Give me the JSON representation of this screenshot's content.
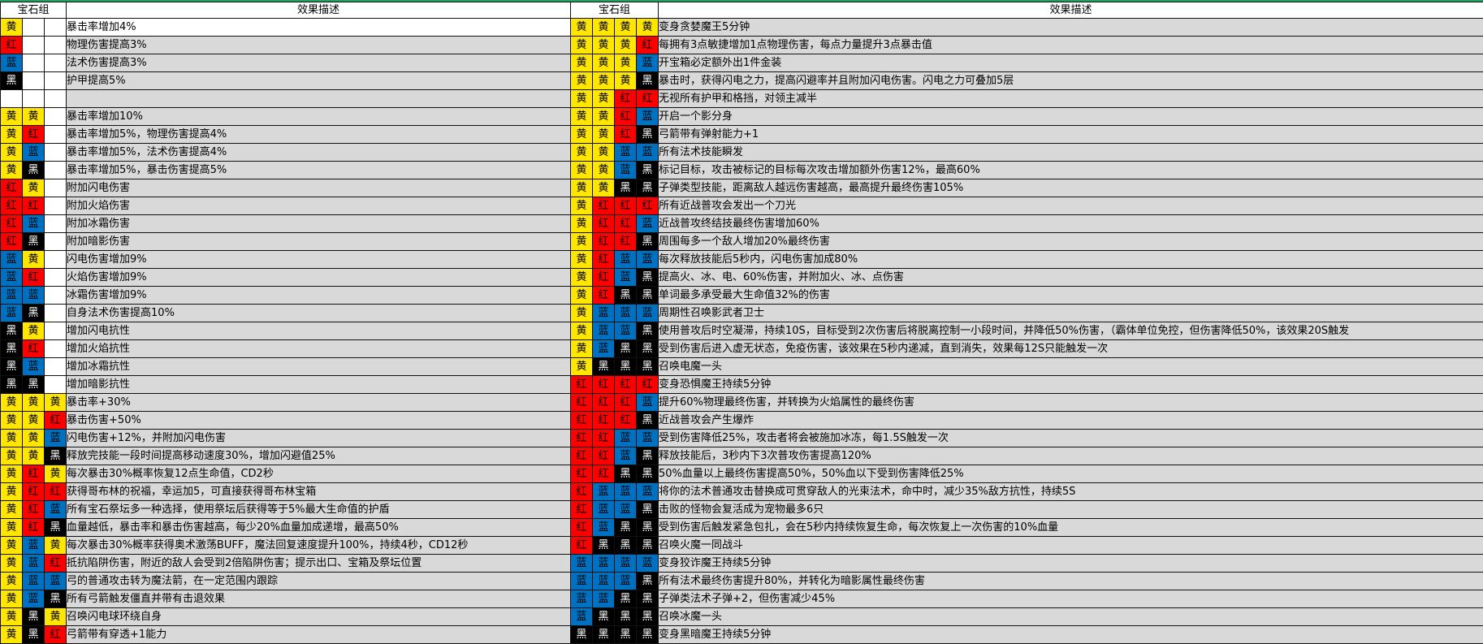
{
  "colors": {
    "yellow": "#ffe600",
    "red": "#ff0000",
    "blue": "#0070c0",
    "black": "#000000",
    "row_bg": "#d9d9d9",
    "accent": "#21a366"
  },
  "left": {
    "gem_header": "宝石组",
    "desc_header": "效果描述",
    "rows": [
      {
        "gems": [
          "黄",
          "",
          ""
        ],
        "desc": "暴击率增加4%",
        "highlight": true
      },
      {
        "gems": [
          "红",
          "",
          ""
        ],
        "desc": "物理伤害提高3%"
      },
      {
        "gems": [
          "蓝",
          "",
          ""
        ],
        "desc": "法术伤害提高3%"
      },
      {
        "gems": [
          "黑",
          "",
          ""
        ],
        "desc": "护甲提高5%"
      },
      {
        "gems": [
          "",
          "",
          ""
        ],
        "desc": ""
      },
      {
        "gems": [
          "黄",
          "黄",
          ""
        ],
        "desc": "暴击率增加10%"
      },
      {
        "gems": [
          "黄",
          "红",
          ""
        ],
        "desc": "暴击率增加5%，物理伤害提高4%"
      },
      {
        "gems": [
          "黄",
          "蓝",
          ""
        ],
        "desc": "暴击率增加5%，法术伤害提高4%"
      },
      {
        "gems": [
          "黄",
          "黑",
          ""
        ],
        "desc": "暴击率增加5%，暴击伤害提高5%"
      },
      {
        "gems": [
          "红",
          "黄",
          ""
        ],
        "desc": "附加闪电伤害"
      },
      {
        "gems": [
          "红",
          "红",
          ""
        ],
        "desc": "附加火焰伤害"
      },
      {
        "gems": [
          "红",
          "蓝",
          ""
        ],
        "desc": "附加冰霜伤害"
      },
      {
        "gems": [
          "红",
          "黑",
          ""
        ],
        "desc": "附加暗影伤害"
      },
      {
        "gems": [
          "蓝",
          "黄",
          ""
        ],
        "desc": "闪电伤害增加9%"
      },
      {
        "gems": [
          "蓝",
          "红",
          ""
        ],
        "desc": "火焰伤害增加9%"
      },
      {
        "gems": [
          "蓝",
          "蓝",
          ""
        ],
        "desc": "冰霜伤害增加9%"
      },
      {
        "gems": [
          "蓝",
          "黑",
          ""
        ],
        "desc": "自身法术伤害提高10%"
      },
      {
        "gems": [
          "黑",
          "黄",
          ""
        ],
        "desc": "增加闪电抗性"
      },
      {
        "gems": [
          "黑",
          "红",
          ""
        ],
        "desc": "增加火焰抗性"
      },
      {
        "gems": [
          "黑",
          "蓝",
          ""
        ],
        "desc": "增加冰霜抗性"
      },
      {
        "gems": [
          "黑",
          "黑",
          ""
        ],
        "desc": "增加暗影抗性"
      },
      {
        "gems": [
          "黄",
          "黄",
          "黄"
        ],
        "desc": "暴击率+30%"
      },
      {
        "gems": [
          "黄",
          "黄",
          "红"
        ],
        "desc": "暴击伤害+50%"
      },
      {
        "gems": [
          "黄",
          "黄",
          "蓝"
        ],
        "desc": "闪电伤害+12%，并附加闪电伤害"
      },
      {
        "gems": [
          "黄",
          "黄",
          "黑"
        ],
        "desc": "释放完技能一段时间提高移动速度30%，增加闪避值25%"
      },
      {
        "gems": [
          "黄",
          "红",
          "黄"
        ],
        "desc": "每次暴击30%概率恢复12点生命值，CD2秒"
      },
      {
        "gems": [
          "黄",
          "红",
          "红"
        ],
        "desc": "获得哥布林的祝福，幸运加5，可直接获得哥布林宝箱"
      },
      {
        "gems": [
          "黄",
          "红",
          "蓝"
        ],
        "desc": "所有宝石祭坛多一种选择，使用祭坛后获得等于5%最大生命值的护盾"
      },
      {
        "gems": [
          "黄",
          "红",
          "黑"
        ],
        "desc": "血量越低，暴击率和暴击伤害越高，每少20%血量加成递增，最高50%"
      },
      {
        "gems": [
          "黄",
          "蓝",
          "黄"
        ],
        "desc": "每次暴击30%概率获得奥术激荡BUFF，魔法回复速度提升100%，持续4秒，CD12秒"
      },
      {
        "gems": [
          "黄",
          "蓝",
          "红"
        ],
        "desc": "抵抗陷阱伤害，附近的敌人会受到2倍陷阱伤害；提示出口、宝箱及祭坛位置"
      },
      {
        "gems": [
          "黄",
          "蓝",
          "蓝"
        ],
        "desc": "弓的普通攻击转为魔法箭，在一定范围内跟踪"
      },
      {
        "gems": [
          "黄",
          "蓝",
          "黑"
        ],
        "desc": "所有弓箭触发僵直并带有击退效果"
      },
      {
        "gems": [
          "黄",
          "黑",
          "黄"
        ],
        "desc": "召唤闪电球环绕自身"
      },
      {
        "gems": [
          "黄",
          "黑",
          "红"
        ],
        "desc": "弓箭带有穿透+1能力"
      }
    ]
  },
  "right": {
    "gem_header": "宝石组",
    "desc_header": "效果描述",
    "rows": [
      {
        "gems": [
          "黄",
          "黄",
          "黄",
          "黄"
        ],
        "desc": "变身贪婪魔王5分钟"
      },
      {
        "gems": [
          "黄",
          "黄",
          "黄",
          "红"
        ],
        "desc": "每拥有3点敏捷增加1点物理伤害，每点力量提升3点暴击值"
      },
      {
        "gems": [
          "黄",
          "黄",
          "黄",
          "蓝"
        ],
        "desc": "开宝箱必定额外出1件金装"
      },
      {
        "gems": [
          "黄",
          "黄",
          "黄",
          "黑"
        ],
        "desc": "暴击时，获得闪电之力，提高闪避率并且附加闪电伤害。闪电之力可叠加5层"
      },
      {
        "gems": [
          "黄",
          "黄",
          "红",
          "红"
        ],
        "desc": "无视所有护甲和格挡，对领主减半"
      },
      {
        "gems": [
          "黄",
          "黄",
          "红",
          "蓝"
        ],
        "desc": "开启一个影分身"
      },
      {
        "gems": [
          "黄",
          "黄",
          "红",
          "黑"
        ],
        "desc": "弓箭带有弹射能力+1"
      },
      {
        "gems": [
          "黄",
          "黄",
          "蓝",
          "蓝"
        ],
        "desc": "所有法术技能瞬发"
      },
      {
        "gems": [
          "黄",
          "黄",
          "蓝",
          "黑"
        ],
        "desc": "标记目标，攻击被标记的目标每次攻击增加额外伤害12%，最高60%"
      },
      {
        "gems": [
          "黄",
          "黄",
          "黑",
          "黑"
        ],
        "desc": "子弹类型技能，距离敌人越远伤害越高，最高提升最终伤害105%"
      },
      {
        "gems": [
          "黄",
          "红",
          "红",
          "红"
        ],
        "desc": "所有近战普攻会发出一个刀光"
      },
      {
        "gems": [
          "黄",
          "红",
          "红",
          "蓝"
        ],
        "desc": "近战普攻终结技最终伤害增加60%"
      },
      {
        "gems": [
          "黄",
          "红",
          "红",
          "黑"
        ],
        "desc": "周围每多一个敌人增加20%最终伤害"
      },
      {
        "gems": [
          "黄",
          "红",
          "蓝",
          "蓝"
        ],
        "desc": "每次释放技能后5秒内，闪电伤害加成80%"
      },
      {
        "gems": [
          "黄",
          "红",
          "蓝",
          "黑"
        ],
        "desc": "提高火、冰、电、60%伤害，并附加火、冰、点伤害"
      },
      {
        "gems": [
          "黄",
          "红",
          "黑",
          "黑"
        ],
        "desc": "单词最多承受最大生命值32%的伤害"
      },
      {
        "gems": [
          "黄",
          "蓝",
          "蓝",
          "蓝"
        ],
        "desc": "周期性召唤影武者卫士"
      },
      {
        "gems": [
          "黄",
          "蓝",
          "蓝",
          "黑"
        ],
        "desc": "使用普攻后时空凝滞，持续10S，目标受到2次伤害后将脱离控制一小段时间，并降低50%伤害，（霸体单位免控，但伤害降低50%，该效果20S触发"
      },
      {
        "gems": [
          "黄",
          "蓝",
          "黑",
          "黑"
        ],
        "desc": "受到伤害后进入虚无状态，免疫伤害，该效果在5秒内递减，直到消失，效果每12S只能触发一次"
      },
      {
        "gems": [
          "黄",
          "黑",
          "黑",
          "黑"
        ],
        "desc": "召唤电魔一头"
      },
      {
        "gems": [
          "红",
          "红",
          "红",
          "红"
        ],
        "desc": "变身恐惧魔王持续5分钟"
      },
      {
        "gems": [
          "红",
          "红",
          "红",
          "蓝"
        ],
        "desc": "提升60%物理最终伤害，并转换为火焰属性的最终伤害"
      },
      {
        "gems": [
          "红",
          "红",
          "红",
          "黑"
        ],
        "desc": "近战普攻会产生爆炸"
      },
      {
        "gems": [
          "红",
          "红",
          "蓝",
          "蓝"
        ],
        "desc": "受到伤害降低25%，攻击者将会被施加冰冻，每1.5S触发一次"
      },
      {
        "gems": [
          "红",
          "红",
          "蓝",
          "黑"
        ],
        "desc": "释放技能后，3秒内下3次普攻伤害提高120%"
      },
      {
        "gems": [
          "红",
          "红",
          "黑",
          "黑"
        ],
        "desc": "50%血量以上最终伤害提高50%，50%血以下受到伤害降低25%"
      },
      {
        "gems": [
          "红",
          "蓝",
          "蓝",
          "蓝"
        ],
        "desc": "将你的法术普通攻击替换成可贯穿敌人的光束法术，命中时，减少35%敌方抗性，持续5S"
      },
      {
        "gems": [
          "红",
          "蓝",
          "蓝",
          "黑"
        ],
        "desc": "击败的怪物会复活成为宠物最多6只"
      },
      {
        "gems": [
          "红",
          "蓝",
          "黑",
          "黑"
        ],
        "desc": "受到伤害后触发紧急包扎，会在5秒内持续恢复生命，每次恢复上一次伤害的10%血量"
      },
      {
        "gems": [
          "红",
          "黑",
          "黑",
          "黑"
        ],
        "desc": "召唤火魔一同战斗"
      },
      {
        "gems": [
          "蓝",
          "蓝",
          "蓝",
          "蓝"
        ],
        "desc": "变身狡诈魔王持续5分钟"
      },
      {
        "gems": [
          "蓝",
          "蓝",
          "蓝",
          "黑"
        ],
        "desc": "所有法术最终伤害提升80%，并转化为暗影属性最终伤害"
      },
      {
        "gems": [
          "蓝",
          "蓝",
          "黑",
          "黑"
        ],
        "desc": "子弹类法术子弹+2，但伤害减少45%"
      },
      {
        "gems": [
          "蓝",
          "黑",
          "黑",
          "黑"
        ],
        "desc": "召唤冰魔一头"
      },
      {
        "gems": [
          "黑",
          "黑",
          "黑",
          "黑"
        ],
        "desc": "变身黑暗魔王持续5分钟"
      }
    ]
  }
}
